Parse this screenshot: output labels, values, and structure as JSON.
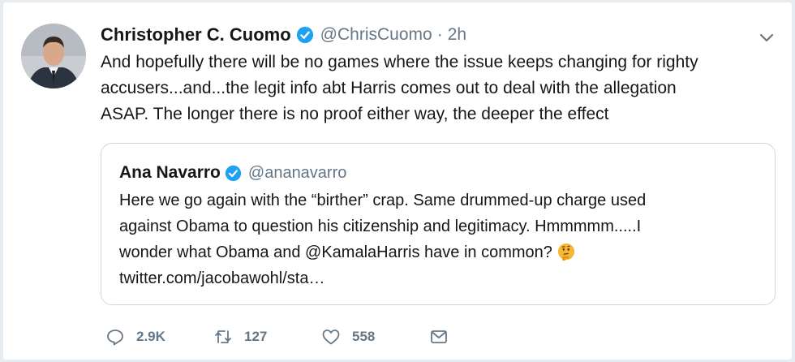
{
  "tweet": {
    "author_name": "Christopher C. Cuomo",
    "author_handle": "@ChrisCuomo",
    "separator": "·",
    "time": "2h",
    "text_lines": [
      "And hopefully there will be no games where the issue keeps changing for righty",
      "accusers...and...the legit info abt Harris comes out to deal with the allegation",
      "ASAP. The longer there is no proof either way, the deeper the effect"
    ]
  },
  "quoted": {
    "author_name": "Ana Navarro",
    "author_handle": "@ananavarro",
    "text_lines": [
      "Here we go again with the “birther” crap. Same drummed-up charge used",
      "against Obama to question his citizenship and legitimacy. Hmmmmm.....I",
      "wonder what Obama and @KamalaHarris have in common?",
      "twitter.com/jacobawohl/sta…"
    ],
    "emoji": "thinking-face"
  },
  "actions": {
    "replies": "2.9K",
    "retweets": "127",
    "likes": "558"
  },
  "colors": {
    "verified": "#1da1f2",
    "secondary_text": "#657786",
    "border": "#ccd6dd",
    "background": "#e6ecf0"
  }
}
